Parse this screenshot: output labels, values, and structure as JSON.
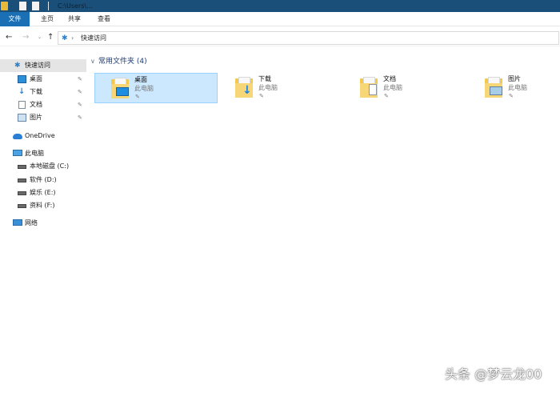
{
  "window": {
    "title": "C:\\Users\\...",
    "titlebar_icons": [
      "folder-icon",
      "document-icon",
      "document-icon"
    ]
  },
  "ribbon": {
    "tabs": [
      {
        "label": "文件",
        "active": true
      },
      {
        "label": "主页"
      },
      {
        "label": "共享"
      },
      {
        "label": "查看"
      }
    ]
  },
  "address": {
    "back": "←",
    "forward": "→",
    "dropdown": "⌄",
    "up": "↑",
    "pin_icon": "✱",
    "chevron": "›",
    "path": "快速访问"
  },
  "sidebar": {
    "items": [
      {
        "label": "快速访问",
        "icon": "quick-access-icon"
      },
      {
        "label": "桌面",
        "icon": "desktop-icon",
        "pinned": true
      },
      {
        "label": "下载",
        "icon": "download-icon",
        "pinned": true
      },
      {
        "label": "文档",
        "icon": "documents-icon",
        "pinned": true
      },
      {
        "label": "图片",
        "icon": "pictures-icon",
        "pinned": true
      },
      {
        "label": "OneDrive",
        "icon": "onedrive-cloud-icon"
      },
      {
        "label": "此电脑",
        "icon": "this-pc-icon"
      },
      {
        "label": "本地磁盘 (C:)",
        "icon": "drive-icon"
      },
      {
        "label": "软件 (D:)",
        "icon": "drive-icon"
      },
      {
        "label": "娱乐 (E:)",
        "icon": "drive-icon"
      },
      {
        "label": "资料 (F:)",
        "icon": "drive-icon"
      },
      {
        "label": "网络",
        "icon": "network-icon"
      }
    ],
    "pin_glyph": "✎"
  },
  "main": {
    "group_chevron": "∨",
    "group_title": "常用文件夹 (4)",
    "folders": [
      {
        "name": "桌面",
        "location": "此电脑",
        "icon": "desktop-folder-icon",
        "selected": true
      },
      {
        "name": "下载",
        "location": "此电脑",
        "icon": "downloads-folder-icon"
      },
      {
        "name": "文档",
        "location": "此电脑",
        "icon": "documents-folder-icon"
      },
      {
        "name": "图片",
        "location": "此电脑",
        "icon": "pictures-folder-icon"
      }
    ],
    "pin_glyph": "✎"
  },
  "watermark": {
    "text": "头条 @梦云龙00"
  },
  "colors": {
    "titlebar": "#1a4f7a",
    "file_tab": "#1a6fb5",
    "selection": "#cce8ff",
    "nav_selection": "#e5e5e5",
    "group_title": "#1d3c7a"
  }
}
